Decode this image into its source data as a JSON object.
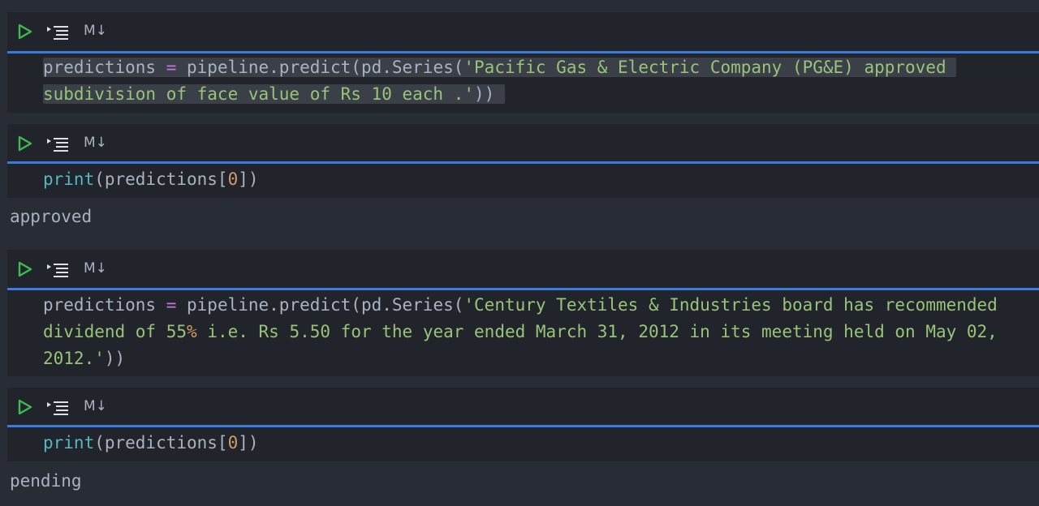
{
  "cell_toolbar": {
    "run_icon": "play-icon",
    "split_icon": "split-cell-icon",
    "markdown_label": "M↓"
  },
  "cells": [
    {
      "code_lines": [
        [
          "predictions ",
          "= ",
          "pipeline.predict(pd.Series(",
          "'Pacific Gas & Electric Company (PG&E) approved"
        ],
        [
          "subdivision of face value of Rs 10 each .'",
          "))"
        ]
      ]
    },
    {
      "code": {
        "fn": "print",
        "open": "(predictions[",
        "num": "0",
        "close": "])"
      },
      "output": "approved"
    },
    {
      "code_lines": [
        [
          "predictions ",
          "= ",
          "pipeline.predict(pd.Series(",
          "'Century Textiles & Industries board has recommended"
        ],
        [
          "dividend of 55",
          "% ",
          "i.e. Rs 5.50 for the year ended March 31, 2012 in its meeting held on May 02,"
        ],
        [
          "2012.'",
          "))"
        ]
      ]
    },
    {
      "code": {
        "fn": "print",
        "open": "(predictions[",
        "num": "0",
        "close": "])"
      },
      "output": "pending"
    }
  ],
  "colors": {
    "background": "#282c34",
    "cell_background": "#21252b",
    "accent_line": "#3b7bdc",
    "run_icon": "#3fb950",
    "string": "#98c379",
    "operator": "#c678dd",
    "builtin": "#56b6c2",
    "number": "#d19a66",
    "text": "#abb2bf"
  }
}
